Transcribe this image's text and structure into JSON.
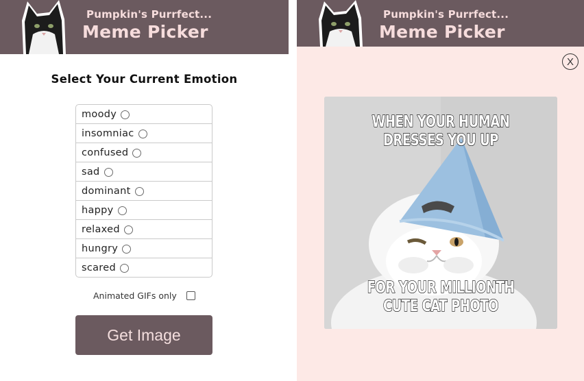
{
  "app": {
    "subtitle": "Pumpkin's Purrfect...",
    "title": "Meme Picker"
  },
  "form": {
    "heading": "Select Your Current Emotion",
    "emotions": [
      {
        "label": "moody"
      },
      {
        "label": "insomniac"
      },
      {
        "label": "confused"
      },
      {
        "label": "sad"
      },
      {
        "label": "dominant"
      },
      {
        "label": "happy"
      },
      {
        "label": "relaxed"
      },
      {
        "label": "hungry"
      },
      {
        "label": "scared"
      }
    ],
    "gif_label": "Animated GIFs only",
    "gif_checked": false,
    "button_label": "Get Image"
  },
  "modal": {
    "close_label": "X",
    "meme_top_text": "When your human dresses you up",
    "meme_bottom_text": "For your millionth cute cat photo"
  },
  "colors": {
    "header_bg": "#6b5a5f",
    "header_text": "#f6dcdc",
    "modal_bg": "#fde9e6",
    "button_bg": "#6b5a5f",
    "button_text": "#f4dede"
  }
}
